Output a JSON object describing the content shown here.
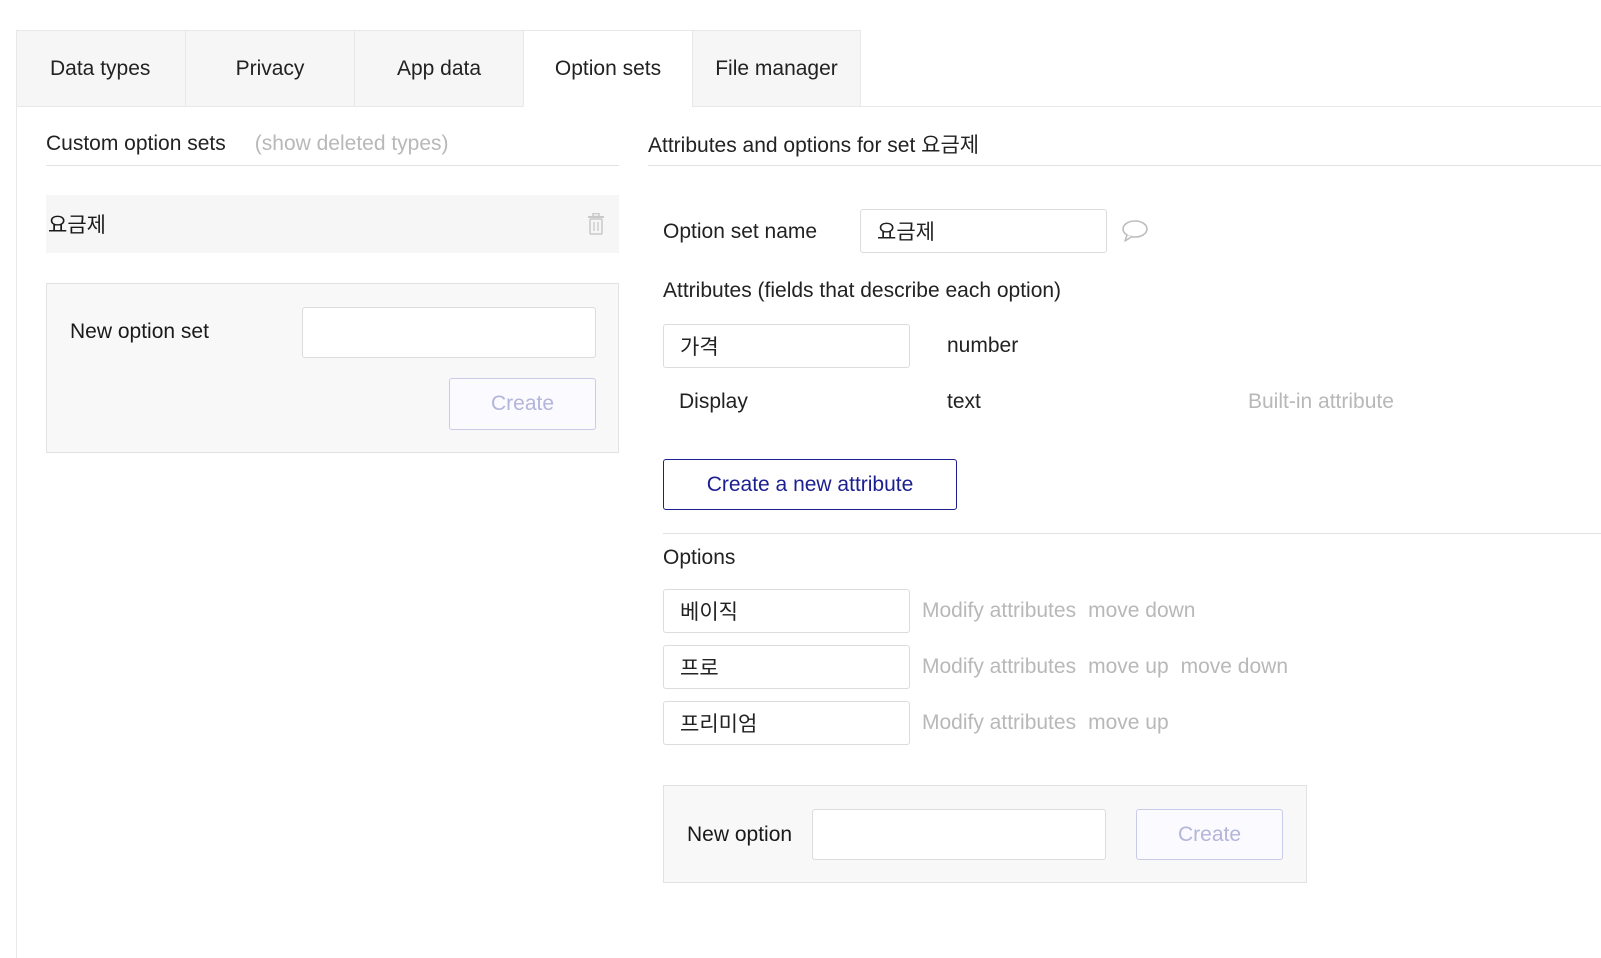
{
  "tabs": [
    {
      "label": "Data types"
    },
    {
      "label": "Privacy"
    },
    {
      "label": "App data"
    },
    {
      "label": "Option sets"
    },
    {
      "label": "File manager"
    }
  ],
  "active_tab": "Option sets",
  "left": {
    "title": "Custom option sets",
    "show_deleted": "(show deleted types)",
    "sets": [
      {
        "name": "요금제"
      }
    ],
    "new_set": {
      "label": "New option set",
      "value": "",
      "placeholder": "",
      "create_label": "Create"
    }
  },
  "right": {
    "title": "Attributes and options for set 요금제",
    "name_label": "Option set name",
    "name_value": "요금제",
    "attributes_label": "Attributes (fields that describe each option)",
    "attributes": [
      {
        "name": "가격",
        "type": "number",
        "note": ""
      },
      {
        "name": "Display",
        "type": "text",
        "note": "Built-in attribute"
      }
    ],
    "new_attribute_label": "Create a new attribute",
    "options_label": "Options",
    "options": [
      {
        "name": "베이직",
        "modify": "Modify attributes",
        "move_up": "",
        "move_down": "move down"
      },
      {
        "name": "프로",
        "modify": "Modify attributes",
        "move_up": "move up",
        "move_down": "move down"
      },
      {
        "name": "프리미엄",
        "modify": "Modify attributes",
        "move_up": "move up",
        "move_down": ""
      }
    ],
    "new_option": {
      "label": "New option",
      "value": "",
      "placeholder": "",
      "create_label": "Create"
    }
  },
  "icons": {
    "trash": "trash-icon",
    "comment": "comment-icon"
  },
  "colors": {
    "accent": "#1b1f8f",
    "muted": "#b8b8b8",
    "tab_bg": "#f6f6f6"
  }
}
